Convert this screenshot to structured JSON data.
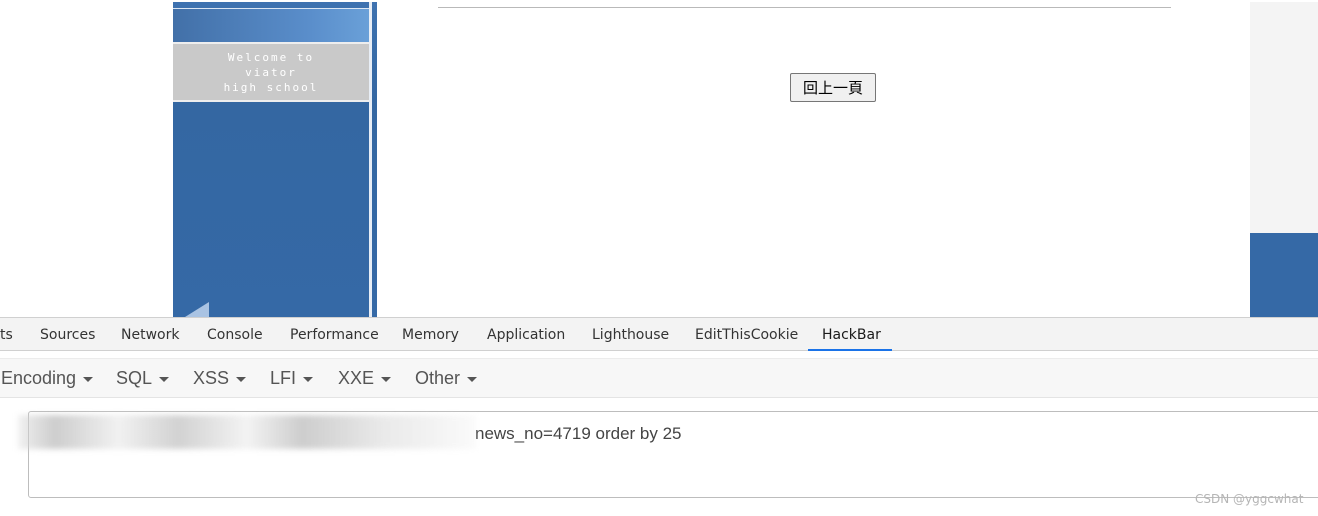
{
  "page": {
    "welcome_line1": "Welcome to",
    "welcome_line2": "viator",
    "welcome_line3": "high school",
    "back_button_label": "回上一頁"
  },
  "devtools": {
    "tabs": [
      {
        "label": "ts"
      },
      {
        "label": "Sources"
      },
      {
        "label": "Network"
      },
      {
        "label": "Console"
      },
      {
        "label": "Performance"
      },
      {
        "label": "Memory"
      },
      {
        "label": "Application"
      },
      {
        "label": "Lighthouse"
      },
      {
        "label": "EditThisCookie"
      },
      {
        "label": "HackBar",
        "active": true
      }
    ]
  },
  "hackbar": {
    "menus": [
      {
        "label": "Encoding"
      },
      {
        "label": "SQL"
      },
      {
        "label": "XSS"
      },
      {
        "label": "LFI"
      },
      {
        "label": "XXE"
      },
      {
        "label": "Other"
      }
    ],
    "url_value": "news_no=4719 order by 25"
  },
  "watermark": "CSDN @yggcwhat",
  "colors": {
    "side_panel_blue": "#3569a6",
    "active_tab_underline": "#1a73e8"
  }
}
